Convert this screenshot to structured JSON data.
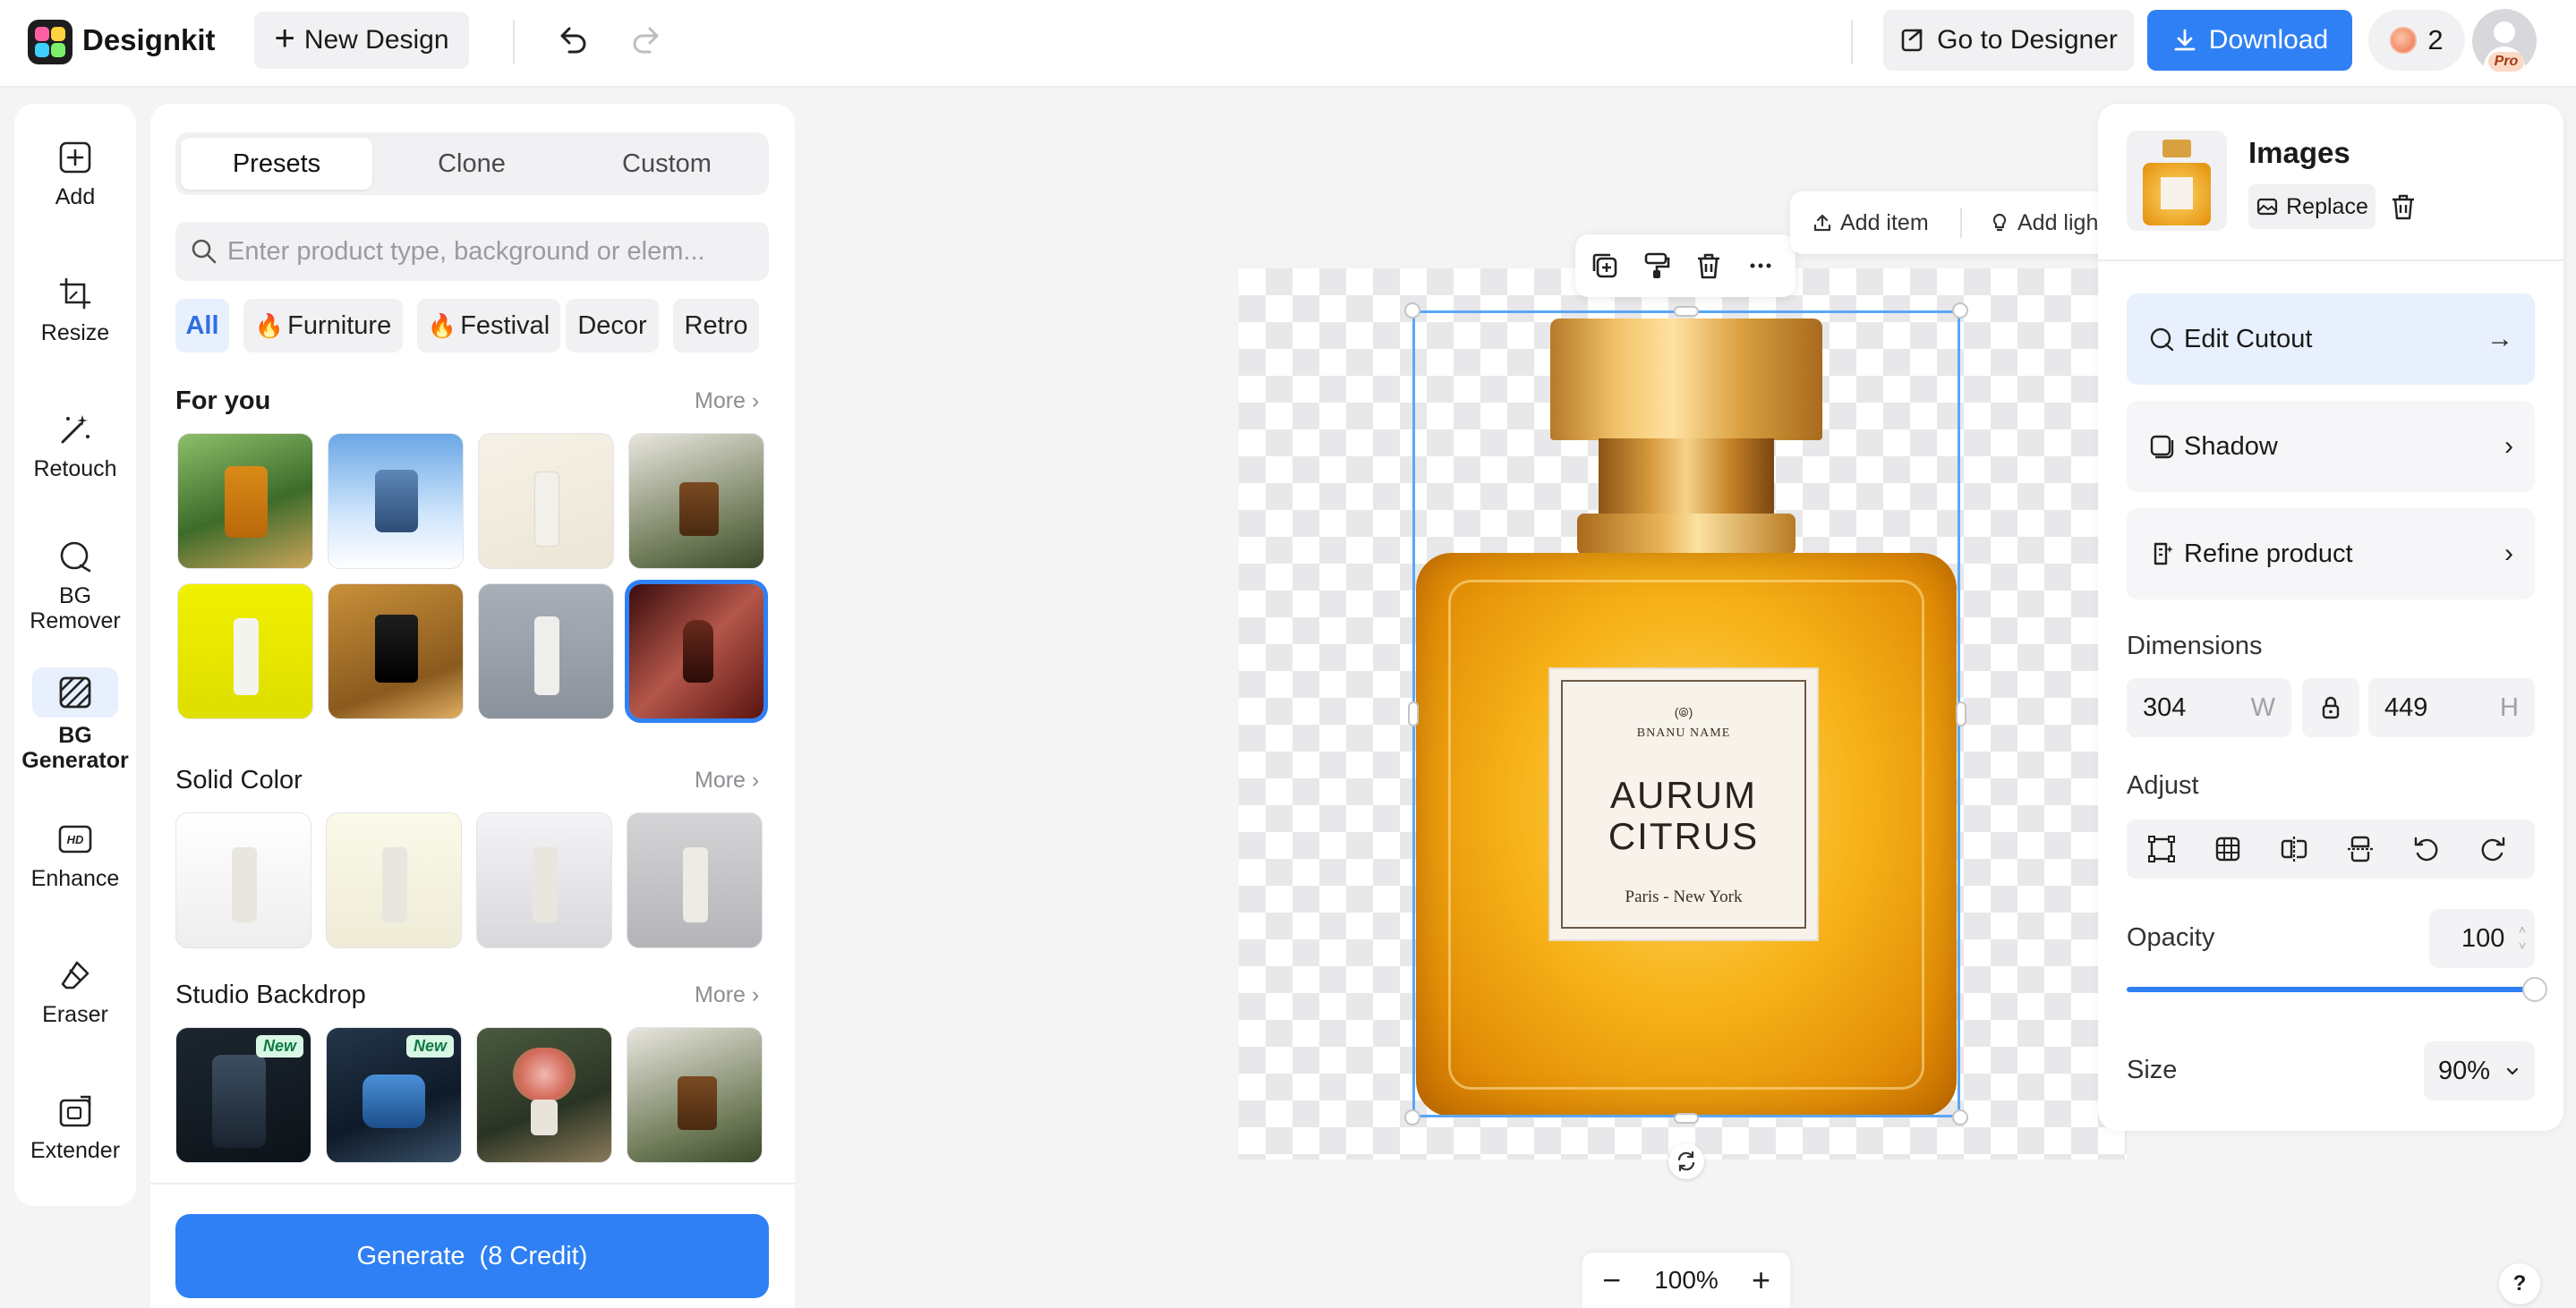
{
  "app": {
    "name": "Designkit",
    "brand_color": "#2f80f4"
  },
  "topbar": {
    "new_design": "New Design",
    "go_to_designer": "Go to Designer",
    "download": "Download",
    "credits": "2",
    "pro_badge": "Pro"
  },
  "rail": {
    "items": [
      {
        "label": "Add",
        "icon": "add-icon"
      },
      {
        "label": "Resize",
        "icon": "crop-icon"
      },
      {
        "label": "Retouch",
        "icon": "magic-wand-icon"
      },
      {
        "label": "BG\nRemover",
        "icon": "bg-remover-icon"
      },
      {
        "label": "BG\nGenerator",
        "icon": "bg-generator-icon",
        "active": true
      },
      {
        "label": "Enhance",
        "icon": "hd-icon"
      },
      {
        "label": "Eraser",
        "icon": "eraser-icon"
      },
      {
        "label": "Extender",
        "icon": "extender-icon"
      }
    ]
  },
  "panel": {
    "tabs": [
      "Presets",
      "Clone",
      "Custom"
    ],
    "active_tab": "Presets",
    "search_placeholder": "Enter product type, background or elem...",
    "chips": [
      "All",
      "Furniture",
      "Festival",
      "Decor",
      "Retro"
    ],
    "sections": {
      "for_you": "For you",
      "solid_color": "Solid Color",
      "studio_backdrop": "Studio Backdrop",
      "more": "More"
    },
    "new_tag": "New",
    "generate": "Generate",
    "generate_cost": "(8 Credit)"
  },
  "canvas": {
    "quickbar": {
      "add_item": "Add item",
      "add_light": "Add ligh"
    },
    "product_label": {
      "brand": "BNANU NAME",
      "name_line1": "AURUM",
      "name_line2": "CITRUS",
      "cities": "Paris - New York"
    },
    "zoom": "100%"
  },
  "right_panel": {
    "title": "Images",
    "replace": "Replace",
    "rows": {
      "edit_cutout": "Edit Cutout",
      "shadow": "Shadow",
      "refine_product": "Refine product"
    },
    "dimensions_label": "Dimensions",
    "width": "304",
    "width_unit": "W",
    "height": "449",
    "height_unit": "H",
    "adjust_label": "Adjust",
    "opacity_label": "Opacity",
    "opacity_value": "100",
    "opacity_level": 1.0,
    "size_label": "Size",
    "size_value": "90%"
  },
  "help": "?"
}
